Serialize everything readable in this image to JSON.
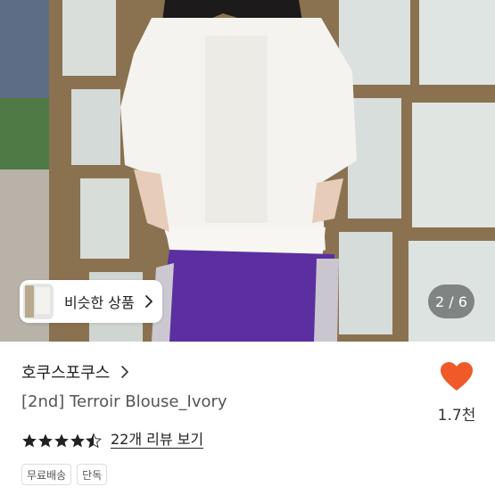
{
  "gallery": {
    "similar_button_label": "비슷한 상품",
    "page_counter": "2 / 6",
    "current_image": 2,
    "total_images": 6
  },
  "product": {
    "brand": "호쿠스포쿠스",
    "title": "[2nd] Terroir Blouse_Ivory",
    "rating": 4.5,
    "review_link": "22개 리뷰 보기",
    "tags": [
      "무료배송",
      "단독"
    ]
  },
  "like": {
    "count": "1.7천"
  },
  "colors": {
    "heart": "#f05a28",
    "star": "#222222"
  }
}
